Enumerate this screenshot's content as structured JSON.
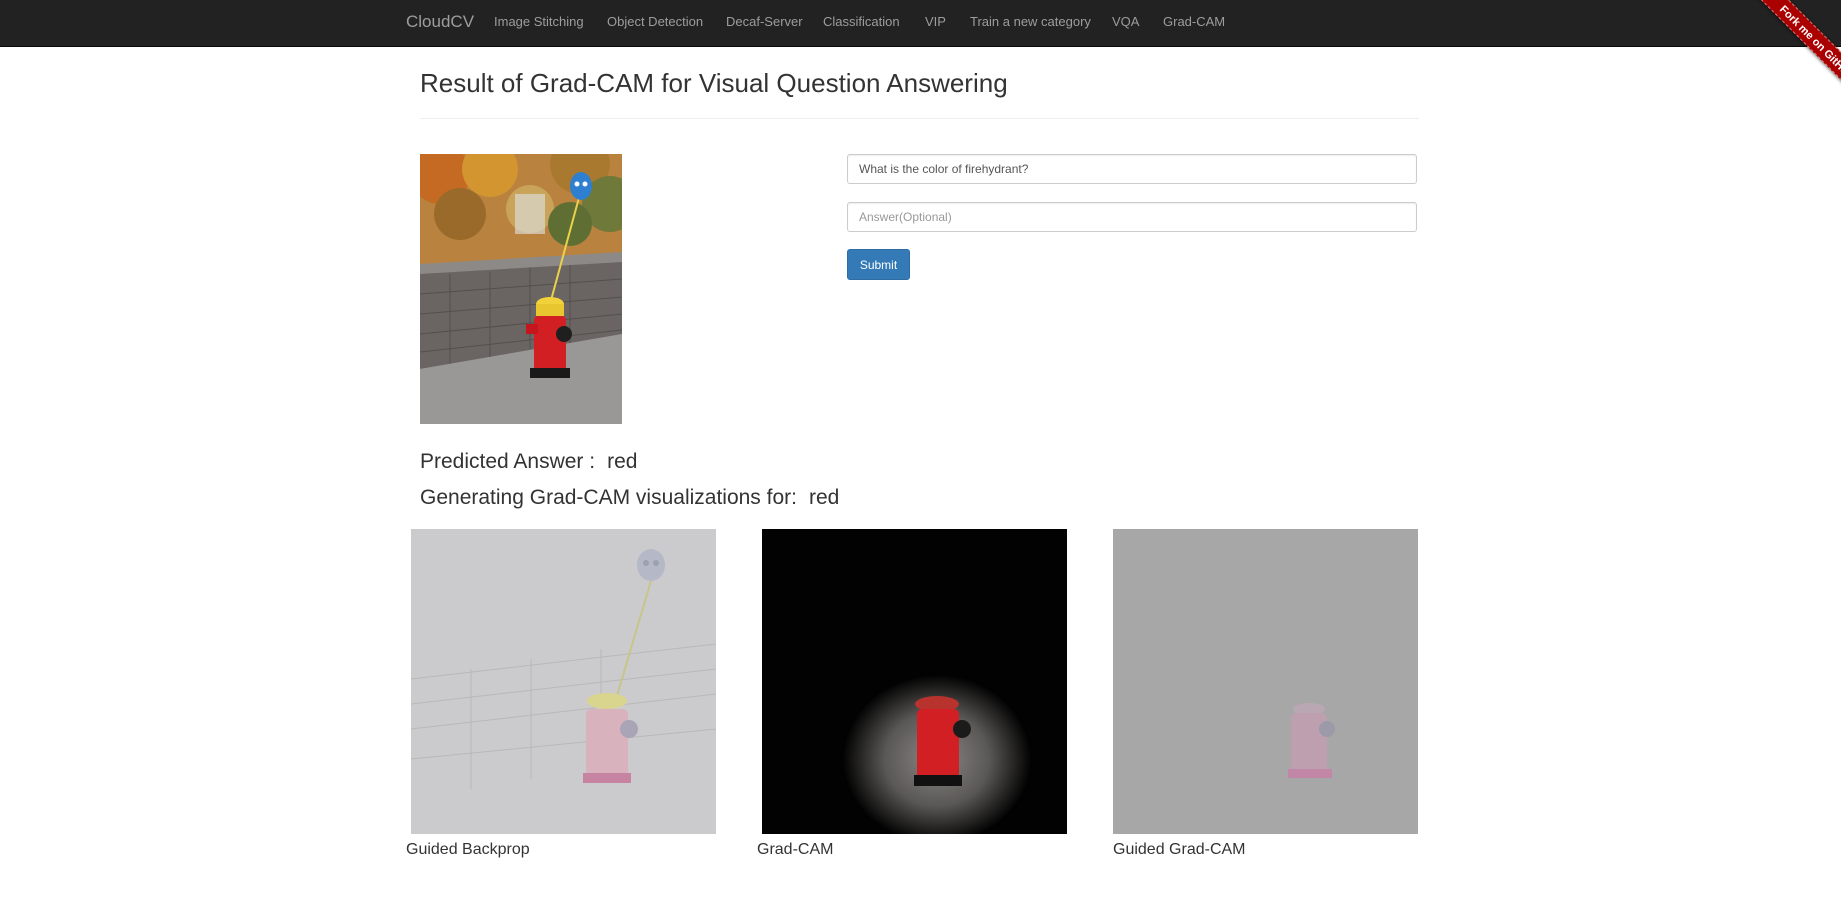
{
  "navbar": {
    "brand": "CloudCV",
    "items": [
      {
        "label": "Image Stitching"
      },
      {
        "label": "Object Detection"
      },
      {
        "label": "Decaf-Server"
      },
      {
        "label": "Classification"
      },
      {
        "label": "VIP"
      },
      {
        "label": "Train a new category"
      },
      {
        "label": "VQA"
      },
      {
        "label": "Grad-CAM"
      }
    ]
  },
  "ribbon": {
    "label": "Fork me on GitHub"
  },
  "page": {
    "title": "Result of Grad-CAM for Visual Question Answering"
  },
  "form": {
    "question_value": "What is the color of firehydrant?",
    "answer_value": "",
    "answer_placeholder": "Answer(Optional)",
    "submit_label": "Submit"
  },
  "results": {
    "predicted_label": "Predicted Answer :",
    "predicted_value": "red",
    "generating_label": "Generating Grad-CAM visualizations for:",
    "generating_value": "red"
  },
  "visualizations": [
    {
      "caption": "Guided Backprop"
    },
    {
      "caption": "Grad-CAM"
    },
    {
      "caption": "Guided Grad-CAM"
    }
  ],
  "colors": {
    "navbar_bg": "#222222",
    "nav_text": "#9d9d9d",
    "primary_button": "#337ab7",
    "ribbon": "#aa0000",
    "hydrant_red": "#d21f24"
  }
}
